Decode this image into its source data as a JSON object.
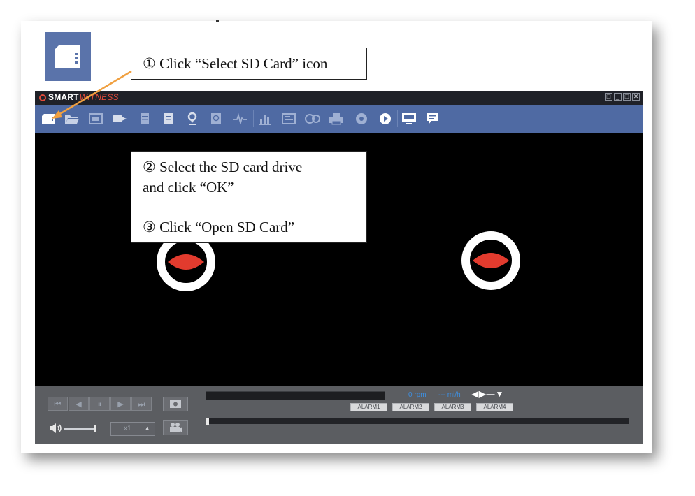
{
  "callouts": {
    "step1": "① Click “Select SD Card” icon",
    "step2_line1": "② Select the SD card drive",
    "step2_line2": "and click “OK”",
    "step3": "③ Click “Open SD Card”"
  },
  "app": {
    "logo_smart": "SMART",
    "logo_witness": "WITNESS",
    "window_buttons": [
      "□",
      "_",
      "□",
      "✕"
    ]
  },
  "toolbar": {
    "icons": [
      "select-sd-card-icon",
      "open-folder-icon",
      "image-icon",
      "export-icon",
      "document-icon",
      "report-icon",
      "map-pin-icon",
      "search-icon",
      "pulse-icon",
      "chart-icon",
      "display-icon",
      "film-icon",
      "print-icon",
      "record-icon",
      "play-icon",
      "monitor-icon",
      "chat-icon"
    ]
  },
  "controls": {
    "playback_buttons": [
      "⏮",
      "◀",
      "⏸",
      "▶",
      "⏭"
    ],
    "speed_value": "x1",
    "speed_up": "▲",
    "rpm": "0 rpm",
    "speed_unit": "--- mi/h",
    "directions": "◀▶—▼",
    "alarms": [
      "ALARM1",
      "ALARM2",
      "ALARM3",
      "ALARM4"
    ]
  },
  "colors": {
    "toolbar": "#4f6aa3",
    "titlebar": "#1f2128",
    "controls": "#5b5d61",
    "accent_red": "#e24b3b",
    "callout_arrow": "#f0a040",
    "readout_blue": "#3e8fe0"
  }
}
